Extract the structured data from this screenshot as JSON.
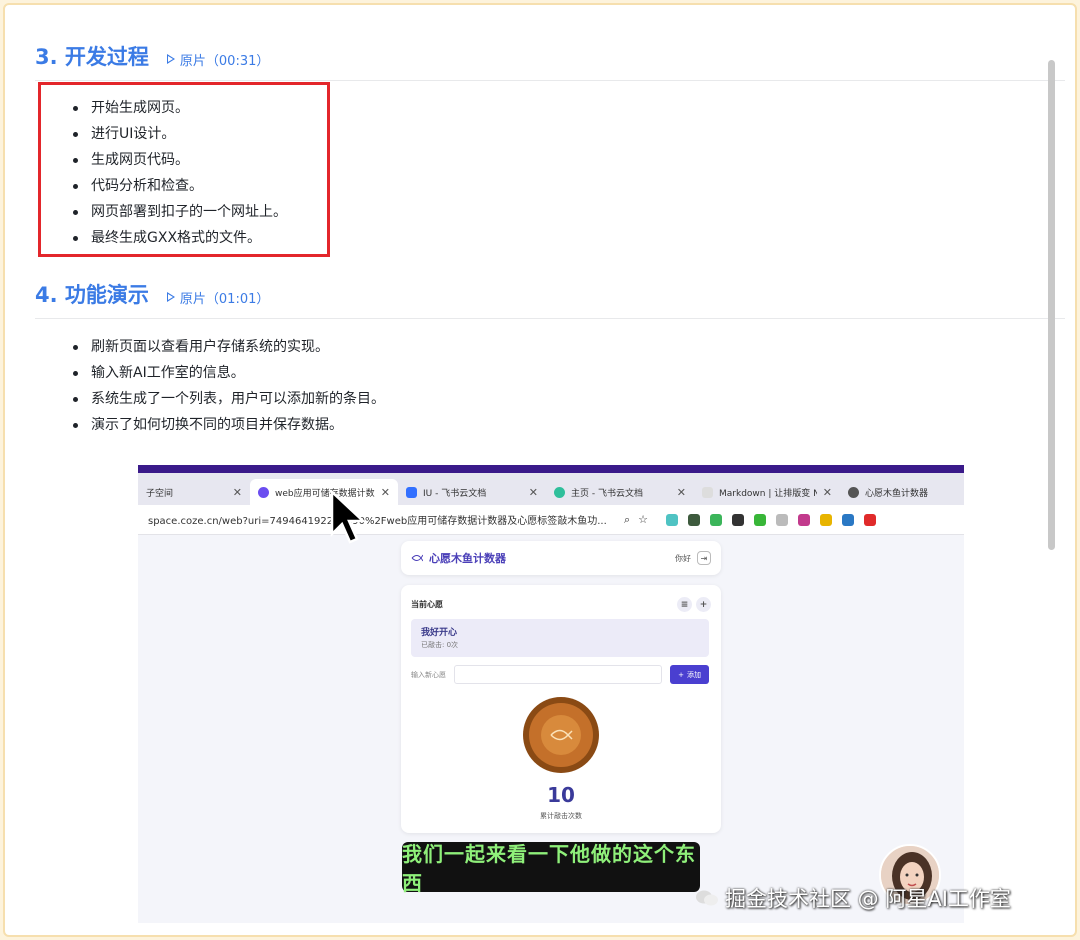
{
  "sections": [
    {
      "title": "3. 开发过程",
      "link_label": "原片（00:31）",
      "bullets": [
        "开始生成网页。",
        "进行UI设计。",
        "生成网页代码。",
        "代码分析和检查。",
        "网页部署到扣子的一个网址上。",
        "最终生成GXX格式的文件。"
      ]
    },
    {
      "title": "4. 功能演示",
      "link_label": "原片（01:01）",
      "bullets": [
        "刷新页面以查看用户存储系统的实现。",
        "输入新AI工作室的信息。",
        "系统生成了一个列表，用户可以添加新的条目。",
        "演示了如何切换不同的项目并保存数据。"
      ]
    }
  ],
  "video": {
    "tabs": [
      {
        "label": "子空间",
        "icon": "folder-icon"
      },
      {
        "label": "web应用可储存数据计数器",
        "icon": "coze-icon",
        "active": true
      },
      {
        "label": "IU - 飞书云文档",
        "icon": "doc-icon"
      },
      {
        "label": "主页 - 飞书云文档",
        "icon": "feishu-icon"
      },
      {
        "label": "Markdown | 让排版变 Nic",
        "icon": "markdown-icon"
      },
      {
        "label": "心愿木鱼计数器",
        "icon": "globe-icon"
      }
    ],
    "url": "space.coze.cn/web?uri=749464192200590%2Fweb应用可储存数据计数器及心愿标签敲木鱼功...",
    "app": {
      "title": "心愿木鱼计数器",
      "greeting": "你好",
      "current_wish_label": "当前心愿",
      "wish_name": "我好开心",
      "wish_sub": "已敲击: 0次",
      "input_placeholder": "输入新心愿",
      "add_label": "添加",
      "count": "10",
      "count_label": "累计敲击次数"
    },
    "subtitle": "我们一起来看一下他做的这个东西"
  },
  "watermark": "掘金技术社区 @ 阿星AI工作室",
  "colors": {
    "accent": "#3b7be5",
    "highlight_box": "#e3262b",
    "app_purple": "#4a3fd0",
    "subtitle_text": "#8ff07a"
  }
}
